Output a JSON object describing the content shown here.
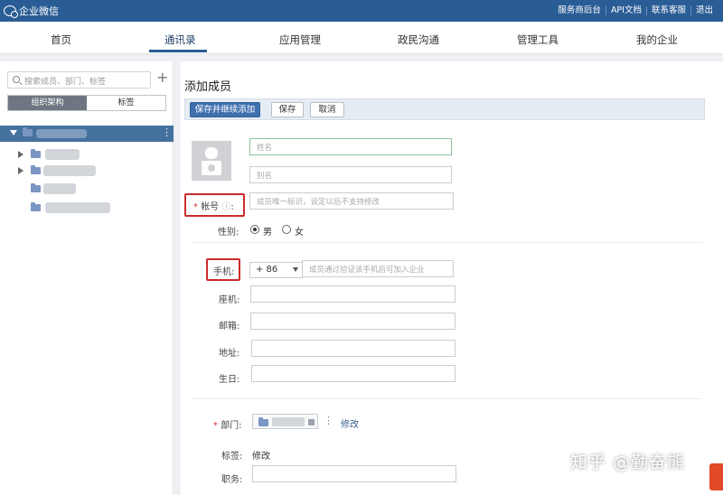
{
  "app": {
    "title": "企业微信"
  },
  "topbar_links": [
    "服务商后台",
    "API文档",
    "联系客服",
    "退出"
  ],
  "nav": {
    "tabs": [
      "首页",
      "通讯录",
      "应用管理",
      "政民沟通",
      "管理工具",
      "我的企业"
    ],
    "active": "通讯录"
  },
  "sidebar": {
    "search_placeholder": "搜索成员、部门、标签",
    "segments": [
      "组织架构",
      "标签"
    ],
    "active_segment": "组织架构"
  },
  "form": {
    "title": "添加成员",
    "buttons": {
      "save_and_continue": "保存并继续添加",
      "save": "保存",
      "cancel": "取消"
    },
    "name_placeholder": "姓名",
    "alias_placeholder": "别名",
    "account_label": "帐号",
    "account_placeholder": "成员唯一标识，设定以后不支持修改",
    "gender_label": "性别:",
    "gender_options": [
      "男",
      "女"
    ],
    "gender_selected": "男",
    "phone_label": "手机:",
    "phone_code": "+ 86",
    "phone_placeholder": "成员通过验证该手机后可加入企业",
    "landline_label": "座机:",
    "email_label": "邮箱:",
    "address_label": "地址:",
    "birthday_label": "生日:",
    "dept_label": "部门:",
    "dept_modify": "修改",
    "tag_label": "标签:",
    "tag_modify": "修改",
    "position_label": "职务:"
  },
  "watermark": "知乎 @勤奋熊",
  "colors": {
    "header": "#2a5d95",
    "primary_button": "#3e6fae",
    "highlight": "#cc2a2a"
  }
}
